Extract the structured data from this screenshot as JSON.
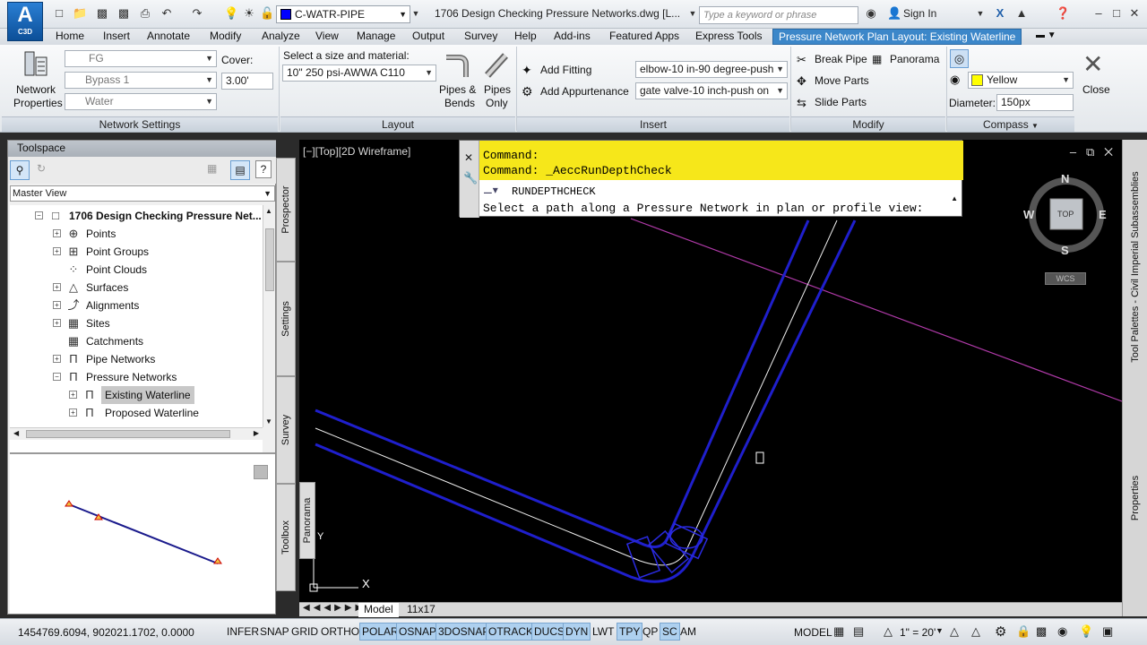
{
  "app": {
    "logo_text": "A",
    "logo_sub": "C3D"
  },
  "titlebar": {
    "layer_name": "C-WATR-PIPE",
    "layer_color": "#0000ff",
    "document_title": "1706 Design Checking Pressure Networks.dwg [L...",
    "search_placeholder": "Type a keyword or phrase",
    "sign_in": "Sign In"
  },
  "tabs": [
    "Home",
    "Insert",
    "Annotate",
    "Modify",
    "Analyze",
    "View",
    "Manage",
    "Output",
    "Survey",
    "Help",
    "Add-ins",
    "Featured Apps",
    "Express Tools"
  ],
  "context_tab": "Pressure Network Plan Layout: Existing Waterline",
  "ribbon": {
    "network_settings": {
      "title": "Network Settings",
      "properties_line1": "Network",
      "properties_line2": "Properties",
      "surface": "FG",
      "alignment": "Bypass 1",
      "parts_list": "Water",
      "cover_label": "Cover:",
      "cover_value": "3.00'"
    },
    "layout": {
      "title": "Layout",
      "size_label": "Select a size and material:",
      "size_value": "10\" 250 psi-AWWA C110",
      "pipes_bends_line1": "Pipes &",
      "pipes_bends_line2": "Bends",
      "pipes_only_line1": "Pipes",
      "pipes_only_line2": "Only"
    },
    "insert": {
      "title": "Insert",
      "add_fitting": "Add Fitting",
      "add_appurtenance": "Add Appurtenance",
      "fitting_value": "elbow-10 in-90 degree-push",
      "appurtenance_value": "gate valve-10 inch-push on"
    },
    "modify": {
      "title": "Modify",
      "break_pipe": "Break Pipe",
      "panorama": "Panorama",
      "move_parts": "Move Parts",
      "slide_parts": "Slide Parts"
    },
    "compass": {
      "title": "Compass",
      "color_value": "Yellow",
      "diameter_label": "Diameter:",
      "diameter_value": "150px",
      "close": "Close"
    }
  },
  "toolspace": {
    "title": "Toolspace",
    "view": "Master View",
    "root": "1706 Design Checking Pressure Net...",
    "items": [
      "Points",
      "Point Groups",
      "Point Clouds",
      "Surfaces",
      "Alignments",
      "Sites",
      "Catchments",
      "Pipe Networks",
      "Pressure Networks"
    ],
    "children": [
      "Existing Waterline",
      "Proposed Waterline"
    ],
    "side_tabs": [
      "Prospector",
      "Settings",
      "Survey",
      "Toolbox"
    ],
    "panorama_tab": "Panorama"
  },
  "drawing": {
    "view_label": "[−][Top][2D Wireframe]",
    "command_history_1": "Command:",
    "command_history_2": "Command: _AeccRunDepthCheck",
    "command_current": "RUNDEPTHCHECK",
    "command_prompt": "Select a path along a Pressure Network in plan or profile view:",
    "viewcube": {
      "n": "N",
      "s": "S",
      "e": "E",
      "w": "W",
      "face": "TOP",
      "wcs": "WCS"
    },
    "layout_tabs": [
      "Model",
      "11x17"
    ],
    "right_tabs": [
      "Tool Palettes - Civil Imperial Subassemblies",
      "Properties"
    ]
  },
  "statusbar": {
    "coordinates": "1454769.6094, 902021.1702, 0.0000",
    "toggles": [
      {
        "label": "INFER",
        "on": false
      },
      {
        "label": "SNAP",
        "on": false
      },
      {
        "label": "GRID",
        "on": false
      },
      {
        "label": "ORTHO",
        "on": false
      },
      {
        "label": "POLAR",
        "on": true
      },
      {
        "label": "OSNAP",
        "on": true
      },
      {
        "label": "3DOSNAP",
        "on": true
      },
      {
        "label": "OTRACK",
        "on": true
      },
      {
        "label": "DUCS",
        "on": true
      },
      {
        "label": "DYN",
        "on": true
      },
      {
        "label": "LWT",
        "on": false
      },
      {
        "label": "TPY",
        "on": true
      },
      {
        "label": "QP",
        "on": false
      },
      {
        "label": "SC",
        "on": true
      },
      {
        "label": "AM",
        "on": false
      }
    ],
    "model": "MODEL",
    "scale": "1\" = 20'"
  }
}
